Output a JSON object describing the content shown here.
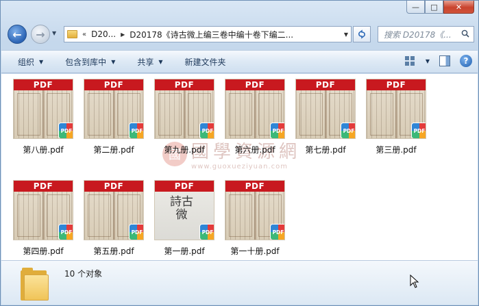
{
  "window": {
    "minimize_glyph": "—",
    "maximize_glyph": "□",
    "close_glyph": "✕"
  },
  "nav": {
    "back_glyph": "←",
    "forward_glyph": "→",
    "address": {
      "chevron": "«",
      "crumbs": [
        "D20...",
        "D20178《诗古微上编三卷中编十卷下编二..."
      ]
    },
    "search_placeholder": "搜索 D20178《..."
  },
  "toolbar": {
    "organize": "组织",
    "include_in_library": "包含到库中",
    "share": "共享",
    "new_folder": "新建文件夹"
  },
  "files": [
    {
      "name": "第八册.pdf",
      "thumb_label": "PDF",
      "kind": "page"
    },
    {
      "name": "第二册.pdf",
      "thumb_label": "PDF",
      "kind": "page"
    },
    {
      "name": "第九册.pdf",
      "thumb_label": "PDF",
      "kind": "page"
    },
    {
      "name": "第六册.pdf",
      "thumb_label": "PDF",
      "kind": "page"
    },
    {
      "name": "第七册.pdf",
      "thumb_label": "PDF",
      "kind": "page"
    },
    {
      "name": "第三册.pdf",
      "thumb_label": "PDF",
      "kind": "page"
    },
    {
      "name": "第四册.pdf",
      "thumb_label": "PDF",
      "kind": "page"
    },
    {
      "name": "第五册.pdf",
      "thumb_label": "PDF",
      "kind": "page"
    },
    {
      "name": "第一册.pdf",
      "thumb_label": "PDF",
      "kind": "title"
    },
    {
      "name": "第一十册.pdf",
      "thumb_label": "PDF",
      "kind": "page"
    }
  ],
  "badge_label": "PDF",
  "title_page_text": "詩古微",
  "watermark": {
    "logo": "國",
    "name": "國學資源網",
    "url": "www.guoxueziyuan.com"
  },
  "status": {
    "count": "10 个对象"
  }
}
